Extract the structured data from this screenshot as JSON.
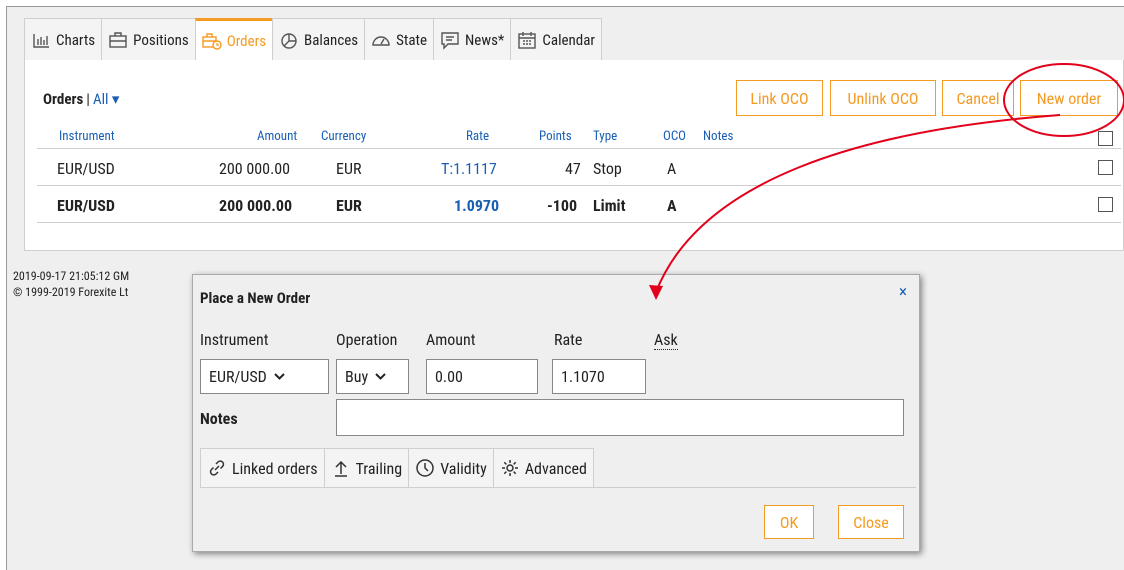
{
  "tabs": [
    {
      "label": "Charts",
      "icon": "charts-icon"
    },
    {
      "label": "Positions",
      "icon": "positions-icon"
    },
    {
      "label": "Orders",
      "icon": "orders-icon",
      "active": true
    },
    {
      "label": "Balances",
      "icon": "balances-icon"
    },
    {
      "label": "State",
      "icon": "state-icon"
    },
    {
      "label": "News*",
      "icon": "news-icon"
    },
    {
      "label": "Calendar",
      "icon": "calendar-icon"
    }
  ],
  "orders": {
    "title": "Orders",
    "separator": "|",
    "filter": "All ▾",
    "buttons": {
      "link_oco": "Link OCO",
      "unlink_oco": "Unlink OCO",
      "cancel": "Cancel",
      "new_order": "New order"
    },
    "columns": {
      "instrument": "Instrument",
      "amount": "Amount",
      "currency": "Currency",
      "rate": "Rate",
      "points": "Points",
      "type": "Type",
      "oco": "OCO",
      "notes": "Notes"
    },
    "rows": [
      {
        "instrument": "EUR/USD",
        "amount": "200 000.00",
        "currency": "EUR",
        "rate": "T:1.1117",
        "points": "47",
        "type": "Stop",
        "oco": "A",
        "notes": "",
        "bold": false
      },
      {
        "instrument": "EUR/USD",
        "amount": "200 000.00",
        "currency": "EUR",
        "rate": "1.0970",
        "points": "-100",
        "type": "Limit",
        "oco": "A",
        "notes": "",
        "bold": true
      }
    ]
  },
  "footer": {
    "timestamp": "2019-09-17 21:05:12 GM",
    "copyright": "© 1999-2019 Forexite Lt"
  },
  "dialog": {
    "title": "Place a New Order",
    "close_glyph": "×",
    "labels": {
      "instrument": "Instrument",
      "operation": "Operation",
      "amount": "Amount",
      "rate": "Rate",
      "ask": "Ask",
      "notes": "Notes"
    },
    "values": {
      "instrument": "EUR/USD",
      "operation": "Buy",
      "amount": "0.00",
      "rate": "1.1070",
      "notes": ""
    },
    "chevron": "❯",
    "tabs": [
      {
        "label": "Linked orders",
        "icon": "link-icon"
      },
      {
        "label": "Trailing",
        "icon": "trailing-arrow-icon"
      },
      {
        "label": "Validity",
        "icon": "clock-icon"
      },
      {
        "label": "Advanced",
        "icon": "gear-icon"
      }
    ],
    "ok": "OK",
    "close": "Close"
  },
  "colors": {
    "accent": "#f59a23",
    "link": "#1a5fb4",
    "annotation": "#e3001b"
  }
}
